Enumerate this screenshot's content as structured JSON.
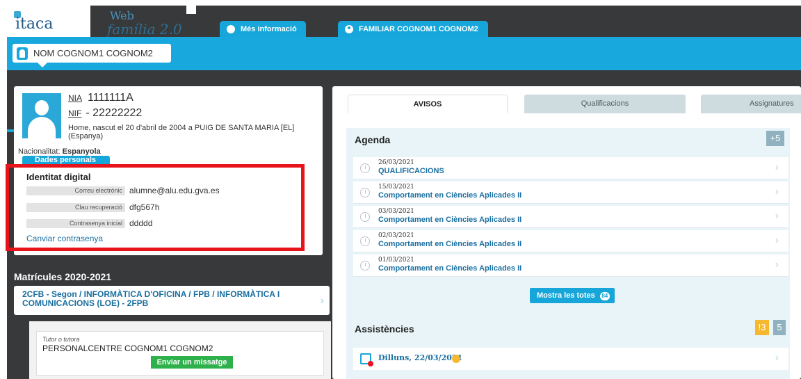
{
  "header": {
    "logo_text": "itaca",
    "brand_line1": "Web",
    "brand_line2": "família 2.0",
    "info_button": "Més informació",
    "user_button": "FAMILIAR COGNOM1 COGNOM2"
  },
  "student": {
    "name": "NOM COGNOM1 COGNOM2",
    "nia_label": "NIA",
    "nia_value": "1111111A",
    "nif_label": "NIF",
    "nif_value": "- 22222222",
    "born": "Home, nascut el 20 d'abril de 2004 a PUIG DE SANTA MARIA [EL] (Espanya)",
    "nationality_label": "Nacionalitat:",
    "nationality_value": "Espanyola",
    "personal_data_button": "Dades personals"
  },
  "identity": {
    "title": "Identitat digital",
    "email_label": "Correu electrònic",
    "email_value": "alumne@alu.edu.gva.es",
    "recovery_label": "Clau recuperació",
    "recovery_value": "dfg567h",
    "initial_pwd_label": "Contrasenya inicial",
    "initial_pwd_value": "ddddd",
    "change_pwd_link": "Canviar contrasenya"
  },
  "enrolments": {
    "title": "Matrícules 2020-2021",
    "course": "2CFB - Segon / INFORMÀTICA D'OFICINA / FPB / INFORMÀTICA I COMUNICACIONS (LOE) - 2FPB",
    "tutor_label": "Tutor o tutora",
    "tutor_name": "PERSONALCENTRE COGNOM1 COGNOM2",
    "message_button": "Enviar un missatge"
  },
  "tabs": {
    "avisos": "AVISOS",
    "qualificacions": "Qualificacions",
    "assignatures": "Assignatures"
  },
  "agenda": {
    "title": "Agenda",
    "more_badge": "+5",
    "items": [
      {
        "date": "26/03/2021",
        "title": "QUALIFICACIONS"
      },
      {
        "date": "15/03/2021",
        "title": "Comportament en Ciències Aplicades II"
      },
      {
        "date": "03/03/2021",
        "title": "Comportament en Ciències Aplicades II"
      },
      {
        "date": "02/03/2021",
        "title": "Comportament en Ciències Aplicades II"
      },
      {
        "date": "01/03/2021",
        "title": "Comportament en Ciències Aplicades II"
      }
    ],
    "show_all_button": "Mostra les totes",
    "show_all_count": "84"
  },
  "attendance": {
    "title": "Assistències",
    "warning_badge": "!3",
    "count_badge": "5",
    "day": "Dilluns, 22/03/2021"
  },
  "colors": {
    "accent": "#18a8dd",
    "dark": "#38393b",
    "highlight_border": "#e8141c",
    "success": "#2eb14b",
    "warning": "#f5b82e"
  }
}
